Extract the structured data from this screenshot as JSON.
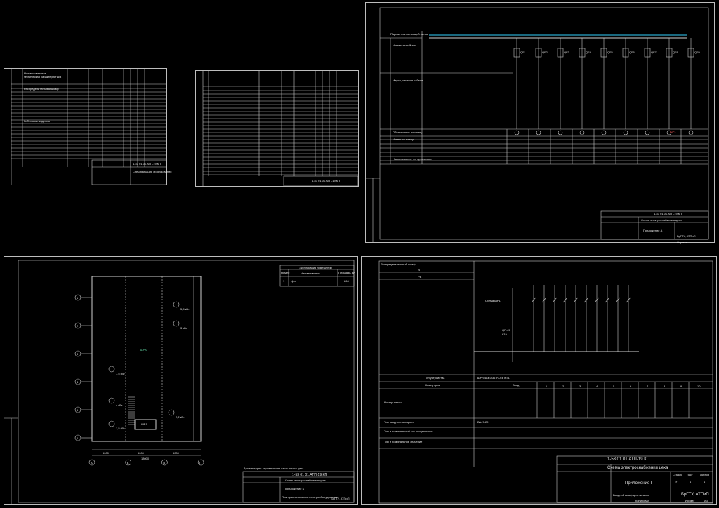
{
  "sheets": {
    "spec1": {
      "code": "1-53 01 01.АТП-19.КП",
      "title": "Спецификация оборудования",
      "rows": [
        "Распределительный шкаф",
        "Автоматический выключатель",
        "Контактор",
        "Кабель ВВГнг",
        "Кабельные изделия"
      ]
    },
    "spec2": {
      "code": "1-53 01 01.АТП-19.КП"
    },
    "scheme1": {
      "code": "1-53 01 01.АТП-19.КП",
      "title": "Схема электроснабжения цеха",
      "appendix": "Приложение А",
      "org": "БрГТУ, АТПиП",
      "sheet_label": "Формат",
      "sheet_format": "А3",
      "left_labels": [
        "Параметры питающей линии",
        "Номинальный ток",
        "Марка, сечение кабеля",
        "Обозначение по плану",
        "Номер по плану",
        "Наименование эл. приемника"
      ],
      "feeders": [
        "QF1",
        "QF2",
        "QF3",
        "QF4",
        "QF5",
        "QF6",
        "QF7",
        "QF8",
        "QF9"
      ],
      "highlight": "ЩР1"
    },
    "plan": {
      "title": "Экспликация помещений",
      "col_num": "Номер",
      "col_name": "Наименование",
      "col_area": "Площадь, м²",
      "room": "Цех",
      "room_no": "1",
      "room_area": "864",
      "node_label": "ШРА",
      "bottom_title": "Архитектурно-строительная часть плана цеха",
      "code": "1-53 01 01.АТП-19.КП",
      "scheme_title": "Схема электроснабжения цеха",
      "appendix": "Приложение Б",
      "sub": "План расположения электрооборудования",
      "org": "БрГТУ, АТПиП",
      "dims": [
        "6000",
        "6000",
        "6000",
        "18000"
      ],
      "axes_h": [
        "А",
        "Б",
        "В",
        "Г"
      ],
      "axes_v": [
        "1",
        "2",
        "3",
        "4",
        "5",
        "6"
      ],
      "panel": "ШР1",
      "loads": [
        "5,5 кВт",
        "3 кВт",
        "7,5 кВт",
        "2,2 кВт",
        "4 кВт",
        "1,5 кВт"
      ]
    },
    "scheme2": {
      "top_label": "Распределительный шкаф",
      "label_n": "N",
      "label_pe": "PE",
      "scheme_name": "Схема ЩР1",
      "qf": "QF-49",
      "qf_rating": "63А",
      "row_labels": [
        "Тип устройства",
        "Номер цепи",
        "Номер линии",
        "Тип вводного аппарата",
        "Тип и номинальный ток расцепителя",
        "Тип и номинальное значение"
      ],
      "device": "ЩРн-48з-0 36 УХЛ4 IP31",
      "inp": "Ввод",
      "circuits": [
        "1",
        "2",
        "3",
        "4",
        "5",
        "6",
        "7",
        "8",
        "9",
        "10"
      ],
      "breaker": "ВА47-29",
      "code": "1-53 01 01.АТП-19.КП",
      "title": "Схема электроснабжения цеха",
      "appendix": "Приложение Г",
      "sub": "Вводной шкаф для питания",
      "org": "БрГТУ, АТПиП",
      "stage": "У",
      "sheet": "1",
      "sheets": "1",
      "col_stage": "Стадия",
      "col_sheet": "Лист",
      "col_sheets": "Листов",
      "format": "А3",
      "copy": "Копировал",
      "format_label": "Формат"
    }
  }
}
